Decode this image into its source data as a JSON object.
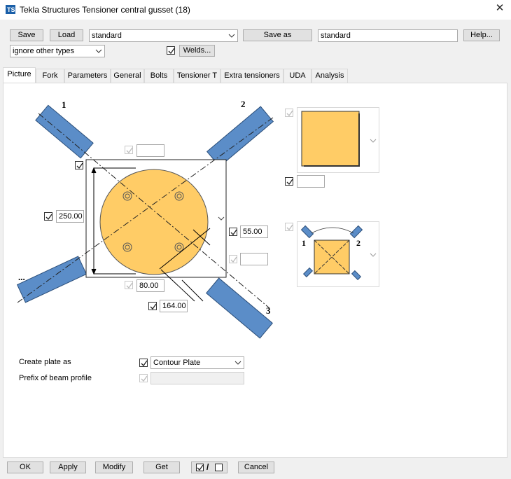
{
  "window": {
    "title": "Tekla Structures  Tensioner central gusset (18)"
  },
  "toolbar": {
    "save_label": "Save",
    "load_label": "Load",
    "preset_value": "standard",
    "save_as_label": "Save as",
    "save_as_value": "standard",
    "help_label": "Help...",
    "filter_value": "ignore other types",
    "welds_label": "Welds..."
  },
  "tabs": [
    {
      "label": "Picture"
    },
    {
      "label": "Fork"
    },
    {
      "label": "Parameters"
    },
    {
      "label": "General"
    },
    {
      "label": "Bolts"
    },
    {
      "label": "Tensioner T"
    },
    {
      "label": "Extra tensioners"
    },
    {
      "label": "UDA"
    },
    {
      "label": "Analysis"
    }
  ],
  "diagram": {
    "member_labels": [
      "1",
      "2",
      "3",
      "..."
    ],
    "dim_left_value": "250.00",
    "dim_right_value": "55.00",
    "dim_bottom_value": "80.00",
    "dim_diag_value": "164.00",
    "top_field_value": "",
    "right_lower_field_value": "",
    "thumb_field_value": "",
    "mini_labels": [
      "1",
      "2"
    ],
    "plate_color": "#FFCC66",
    "member_color": "#5B8DC8"
  },
  "form": {
    "create_plate_label": "Create plate as",
    "create_plate_value": "Contour Plate",
    "prefix_label": "Prefix of beam profile",
    "prefix_value": ""
  },
  "footer": {
    "ok_label": "OK",
    "apply_label": "Apply",
    "modify_label": "Modify",
    "get_label": "Get",
    "toggle_label": "/",
    "cancel_label": "Cancel"
  }
}
